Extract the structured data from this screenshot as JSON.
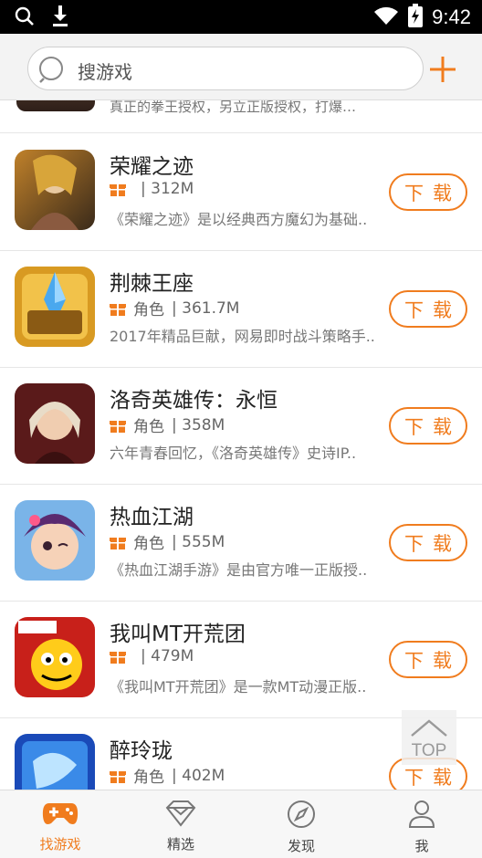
{
  "status_bar": {
    "time": "9:42"
  },
  "search": {
    "placeholder": "搜游戏"
  },
  "partial_item": {
    "desc": "真正的拳王授权，另立正版授权，打爆…"
  },
  "games": [
    {
      "name": "荣耀之迹",
      "tag": "",
      "size": "| 312M",
      "desc": "《荣耀之迹》是以经典西方魔幻为基础..",
      "button": "下载"
    },
    {
      "name": "荆棘王座",
      "tag": "角色",
      "size": "| 361.7M",
      "desc": "2017年精品巨献，网易即时战斗策略手..",
      "button": "下载"
    },
    {
      "name": "洛奇英雄传：永恒",
      "tag": "角色",
      "size": "| 358M",
      "desc": "六年青春回忆，《洛奇英雄传》史诗IP..",
      "button": "下载"
    },
    {
      "name": "热血江湖",
      "tag": "角色",
      "size": "| 555M",
      "desc": "《热血江湖手游》是由官方唯一正版授..",
      "button": "下载"
    },
    {
      "name": "我叫MT开荒团",
      "tag": "",
      "size": "| 479M",
      "desc": "《我叫MT开荒团》是一款MT动漫正版..",
      "button": "下载"
    },
    {
      "name": "醉玲珑",
      "tag": "角色",
      "size": "| 402M",
      "desc": "",
      "button": "下载"
    }
  ],
  "top_button": {
    "label": "TOP"
  },
  "nav": [
    {
      "label": "找游戏",
      "icon": "gamepad-icon"
    },
    {
      "label": "精选",
      "icon": "diamond-icon"
    },
    {
      "label": "发现",
      "icon": "compass-icon"
    },
    {
      "label": "我",
      "icon": "user-icon"
    }
  ],
  "colors": {
    "accent": "#f07c1e",
    "status_bar": "#000000",
    "header_bg": "#f3f3f3"
  }
}
